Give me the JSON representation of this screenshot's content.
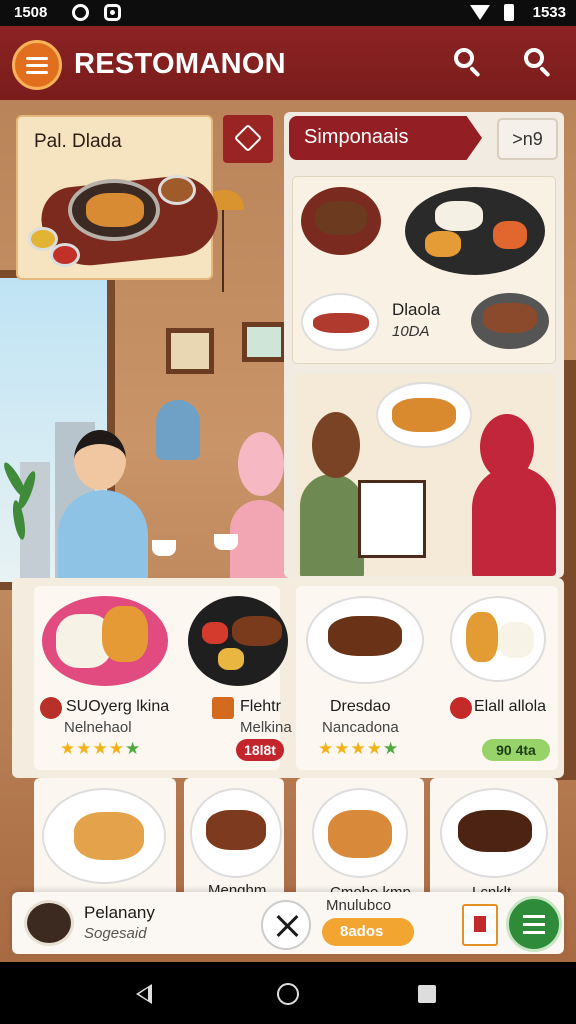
{
  "status_bar": {
    "time_left": "1508",
    "time_right": "1533"
  },
  "app_bar": {
    "title": "RESTOMANON"
  },
  "featured": {
    "label": "Pal. Dlada"
  },
  "right_panel": {
    "section_title": "Simponaais",
    "more_button": ">n9",
    "dish_name": "Dlaola",
    "dish_price": "10DA"
  },
  "cards": [
    {
      "name": "SUOyerg lkina",
      "sub": "Nelnehaol",
      "rating": 4,
      "price": ""
    },
    {
      "name": "Flehtr",
      "sub": "Melkina",
      "rating": 0,
      "price": "18l8t"
    },
    {
      "name": "Dresdao",
      "sub": "Nancadona",
      "rating": 4,
      "price": ""
    },
    {
      "name": "Elall allola",
      "sub": "",
      "rating": 0,
      "price": "90 4ta"
    }
  ],
  "lower_cards": [
    {
      "label": ""
    },
    {
      "label": "Menghm"
    },
    {
      "label": "Cmobe kmp"
    },
    {
      "label": "Lcnklt"
    }
  ],
  "bottom_bar": {
    "title": "Pelanany",
    "sub": "Sogesaid",
    "mid_label": "Mnulubco",
    "order_label": "8ados"
  },
  "colors": {
    "brand": "#8c2323",
    "accent": "#f3a532",
    "green": "#2e8b3a"
  },
  "icons": {
    "search": "search-icon",
    "menu": "menu-icon",
    "cart": "cart-icon"
  }
}
